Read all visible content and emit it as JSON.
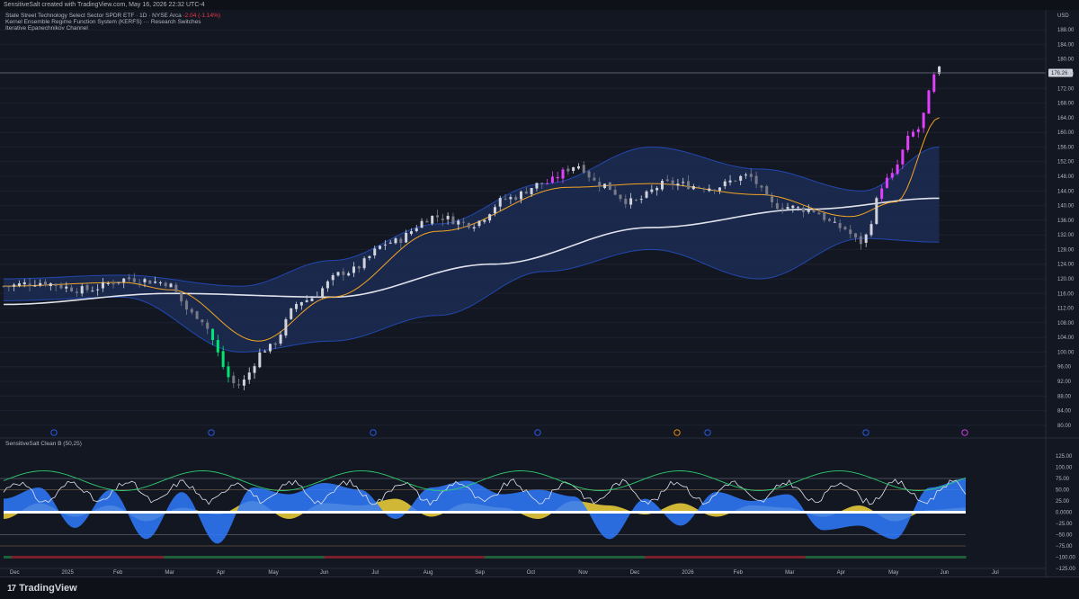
{
  "header": {
    "credit": "SensitiveSalt created with TradingView.com, May 16, 2026 22:32 UTC-4"
  },
  "legend": {
    "symbol_line": "State Street Technology Select Sector SPDR ETF · 1D · NYSE Arca",
    "change": "-2.04 (-1.14%)",
    "indicator_1": "Kernel Ensemble Regime Function System (KERFS) ··· Research Switches",
    "indicator_2": "Iterative Epanechnikov Channel",
    "oscillator": "SensitiveSalt Clean B (50,25)"
  },
  "price_axis": {
    "currency": "USD",
    "ticks": [
      "188.00",
      "184.00",
      "180.00",
      "176.00",
      "172.00",
      "168.00",
      "164.00",
      "160.00",
      "156.00",
      "152.00",
      "148.00",
      "144.00",
      "140.00",
      "136.00",
      "132.00",
      "128.00",
      "124.00",
      "120.00",
      "116.00",
      "112.00",
      "108.00",
      "104.00",
      "100.00",
      "96.00",
      "92.00",
      "88.00",
      "84.00",
      "80.00"
    ],
    "last_price": "176.26"
  },
  "osc_axis": {
    "ticks": [
      "125.00",
      "100.00",
      "75.00",
      "50.00",
      "25.00",
      "0.0000",
      "−25.00",
      "−50.00",
      "−75.00",
      "−100.00",
      "−125.00"
    ]
  },
  "time_axis": {
    "labels": [
      "Dec",
      "2025",
      "Feb",
      "Mar",
      "Apr",
      "May",
      "Jun",
      "Jul",
      "Aug",
      "Sep",
      "Oct",
      "Nov",
      "Dec",
      "2026",
      "Feb",
      "Mar",
      "Apr",
      "May",
      "Jun",
      "Jul"
    ]
  },
  "footer": {
    "brand": "TradingView",
    "mark": "17"
  },
  "colors": {
    "background": "#131722",
    "bull_candle": "#d1d4dc",
    "bull_strong": "#e040fb",
    "bear_strong": "#00e676",
    "channel_fill": "#1c2b52",
    "channel_edge": "#2962ff",
    "kernel_line": "#f5a623",
    "trend_line": "#e0e3eb",
    "osc_blue": "#2f7bff",
    "osc_yellow": "#f2d43a",
    "osc_red": "#d32f2f",
    "osc_green": "#1e8e3e"
  },
  "chart_data": [
    {
      "type": "candlestick",
      "title": "State Street Technology Select Sector SPDR ETF · 1D · NYSE Arca",
      "ylim": [
        78,
        190
      ],
      "x_range": [
        "2024-11-25",
        "2026-07-15"
      ],
      "last_value": 176.26,
      "series": [
        {
          "name": "price",
          "x": [
            "2024-11-25",
            "2024-12-15",
            "2025-01-10",
            "2025-02-05",
            "2025-02-25",
            "2025-03-15",
            "2025-04-08",
            "2025-04-25",
            "2025-05-15",
            "2025-06-10",
            "2025-07-05",
            "2025-07-30",
            "2025-08-20",
            "2025-09-10",
            "2025-09-30",
            "2025-10-20",
            "2025-11-01",
            "2025-11-20",
            "2025-12-10",
            "2026-01-05",
            "2026-01-25",
            "2026-02-10",
            "2026-03-01",
            "2026-03-20",
            "2026-03-31",
            "2026-04-15",
            "2026-05-01",
            "2026-05-15"
          ],
          "values": [
            118,
            119,
            117,
            120,
            119,
            110,
            91,
            101,
            114,
            122,
            130,
            137,
            135,
            142,
            146,
            151,
            146,
            141,
            146,
            145,
            148,
            140,
            139,
            134,
            130,
            147,
            160,
            177
          ]
        },
        {
          "name": "channel_upper",
          "x": [
            "2024-11-25",
            "2025-02-01",
            "2025-04-10",
            "2025-06-01",
            "2025-08-01",
            "2025-10-01",
            "2025-12-01",
            "2026-02-01",
            "2026-04-01",
            "2026-05-15"
          ],
          "values": [
            120,
            121,
            118,
            125,
            135,
            146,
            156,
            150,
            144,
            156
          ]
        },
        {
          "name": "channel_lower",
          "x": [
            "2024-11-25",
            "2025-02-01",
            "2025-04-10",
            "2025-06-01",
            "2025-08-01",
            "2025-10-01",
            "2025-12-01",
            "2026-02-01",
            "2026-04-01",
            "2026-05-15"
          ],
          "values": [
            114,
            115,
            100,
            103,
            110,
            122,
            128,
            120,
            131,
            130
          ]
        },
        {
          "name": "kernel",
          "x": [
            "2024-11-25",
            "2025-02-01",
            "2025-03-01",
            "2025-04-20",
            "2025-06-01",
            "2025-08-01",
            "2025-10-15",
            "2025-12-01",
            "2026-02-01",
            "2026-03-25",
            "2026-04-20",
            "2026-05-15"
          ],
          "values": [
            118,
            119,
            117,
            103,
            115,
            133,
            145,
            146,
            143,
            137,
            141,
            164
          ]
        },
        {
          "name": "trend",
          "x": [
            "2024-11-25",
            "2025-03-01",
            "2025-06-01",
            "2025-09-01",
            "2025-12-01",
            "2026-03-01",
            "2026-05-15"
          ],
          "values": [
            113,
            116,
            115,
            124,
            134,
            139,
            142
          ]
        }
      ]
    },
    {
      "type": "area",
      "title": "SensitiveSalt Clean B (50,25)",
      "ylim": [
        -125,
        125
      ],
      "series": [
        {
          "name": "blue",
          "values": [
            30,
            55,
            -35,
            50,
            -60,
            45,
            -70,
            55,
            40,
            65,
            50,
            -15,
            55,
            70,
            40,
            50,
            35,
            -60,
            30,
            -30,
            45,
            25,
            40,
            -40,
            -30,
            -60,
            55,
            75
          ]
        },
        {
          "name": "yellow",
          "values": [
            -15,
            20,
            -10,
            15,
            -20,
            10,
            -5,
            25,
            -15,
            20,
            15,
            30,
            -10,
            20,
            10,
            -15,
            25,
            15,
            -5,
            20,
            -10,
            15,
            10,
            -10,
            15,
            -20,
            5,
            10
          ]
        }
      ]
    }
  ]
}
